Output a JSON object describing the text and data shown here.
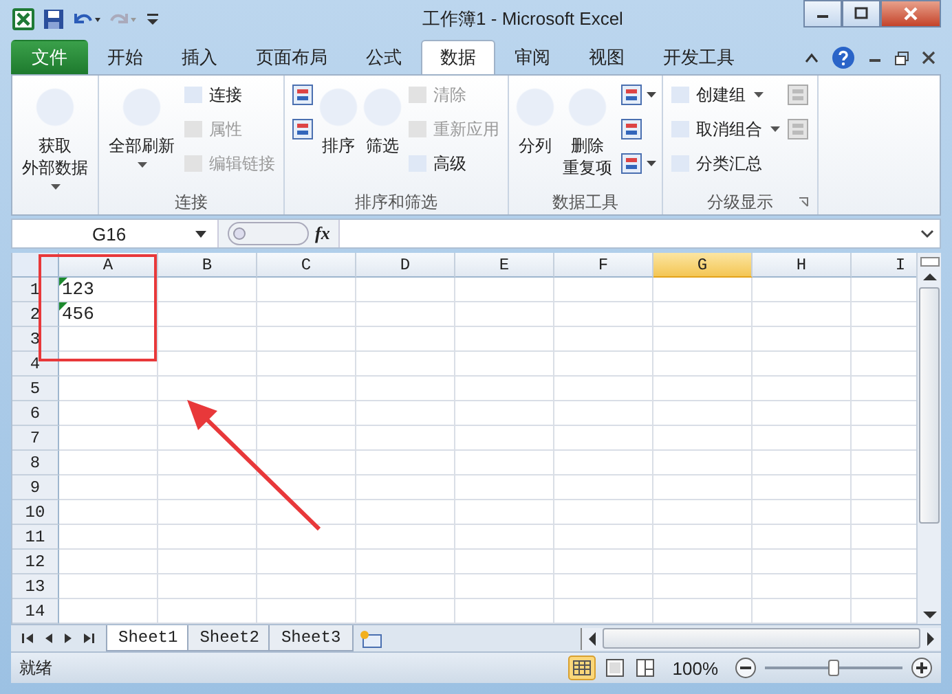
{
  "window": {
    "title": "工作簿1  -  Microsoft Excel"
  },
  "tabs": [
    {
      "label": "文件",
      "kind": "file",
      "selected": false
    },
    {
      "label": "开始",
      "kind": "tab",
      "selected": false
    },
    {
      "label": "插入",
      "kind": "tab",
      "selected": false
    },
    {
      "label": "页面布局",
      "kind": "tab",
      "selected": false
    },
    {
      "label": "公式",
      "kind": "tab",
      "selected": false
    },
    {
      "label": "数据",
      "kind": "tab",
      "selected": true
    },
    {
      "label": "审阅",
      "kind": "tab",
      "selected": false
    },
    {
      "label": "视图",
      "kind": "tab",
      "selected": false
    },
    {
      "label": "开发工具",
      "kind": "tab",
      "selected": false
    }
  ],
  "ribbon": {
    "groups": [
      {
        "columns": [
          [
            {
              "kind": "large",
              "lines": [
                "获取",
                "外部数据"
              ],
              "dropdown": true
            }
          ]
        ]
      },
      {
        "label": "连接",
        "columns": [
          [
            {
              "kind": "large",
              "lines": [
                "全部刷新"
              ],
              "dropdown": true
            }
          ],
          [
            {
              "kind": "small",
              "label": "连接",
              "disabled": false
            },
            {
              "kind": "small",
              "label": "属性",
              "disabled": true
            },
            {
              "kind": "small",
              "label": "编辑链接",
              "disabled": true
            }
          ]
        ]
      },
      {
        "label": "排序和筛选",
        "columns": [
          [
            {
              "kind": "icon",
              "disabled": false
            },
            {
              "kind": "icon",
              "disabled": false
            }
          ],
          [
            {
              "kind": "large",
              "lines": [
                "排序"
              ],
              "disabled": false
            }
          ],
          [
            {
              "kind": "large",
              "lines": [
                "筛选"
              ],
              "disabled": false
            }
          ],
          [
            {
              "kind": "small",
              "label": "清除",
              "disabled": true
            },
            {
              "kind": "small",
              "label": "重新应用",
              "disabled": true
            },
            {
              "kind": "small",
              "label": "高级",
              "disabled": false
            }
          ]
        ]
      },
      {
        "label": "数据工具",
        "columns": [
          [
            {
              "kind": "large",
              "lines": [
                "分列"
              ],
              "disabled": false
            }
          ],
          [
            {
              "kind": "large",
              "lines": [
                "删除",
                "重复项"
              ],
              "disabled": false
            }
          ],
          [
            {
              "kind": "icon",
              "dropdown": true,
              "disabled": false
            },
            {
              "kind": "icon",
              "disabled": false
            },
            {
              "kind": "icon",
              "dropdown": true,
              "disabled": false
            }
          ]
        ]
      },
      {
        "label": "分级显示",
        "launcher": true,
        "columns": [
          [
            {
              "kind": "small",
              "label": "创建组",
              "dropdown": true,
              "disabled": false
            },
            {
              "kind": "small",
              "label": "取消组合",
              "dropdown": true,
              "disabled": false
            },
            {
              "kind": "small",
              "label": "分类汇总",
              "disabled": false
            }
          ],
          [
            {
              "kind": "icon",
              "disabled": true
            },
            {
              "kind": "icon",
              "disabled": true
            }
          ]
        ]
      }
    ]
  },
  "formula_bar": {
    "name_box": "G16",
    "function_label": "fx"
  },
  "grid": {
    "columns": [
      {
        "label": "A",
        "selected": false
      },
      {
        "label": "B",
        "selected": false
      },
      {
        "label": "C",
        "selected": false
      },
      {
        "label": "D",
        "selected": false
      },
      {
        "label": "E",
        "selected": false
      },
      {
        "label": "F",
        "selected": false
      },
      {
        "label": "G",
        "selected": true
      },
      {
        "label": "H",
        "selected": false
      },
      {
        "label": "I",
        "selected": false
      }
    ],
    "rows": [
      {
        "label": "1",
        "cells": [
          {
            "text": "123",
            "flagged": true
          }
        ]
      },
      {
        "label": "2",
        "cells": [
          {
            "text": "456",
            "flagged": true
          }
        ]
      },
      {
        "label": "3"
      },
      {
        "label": "4"
      },
      {
        "label": "5"
      },
      {
        "label": "6"
      },
      {
        "label": "7"
      },
      {
        "label": "8"
      },
      {
        "label": "9"
      },
      {
        "label": "10"
      },
      {
        "label": "11"
      },
      {
        "label": "12"
      },
      {
        "label": "13"
      },
      {
        "label": "14"
      }
    ]
  },
  "sheets": [
    {
      "label": "Sheet1",
      "selected": true
    },
    {
      "label": "Sheet2",
      "selected": false
    },
    {
      "label": "Sheet3",
      "selected": false
    }
  ],
  "status_bar": {
    "status": "就绪",
    "zoom": "100%",
    "zoom_slider": {
      "level": 0.5
    }
  }
}
